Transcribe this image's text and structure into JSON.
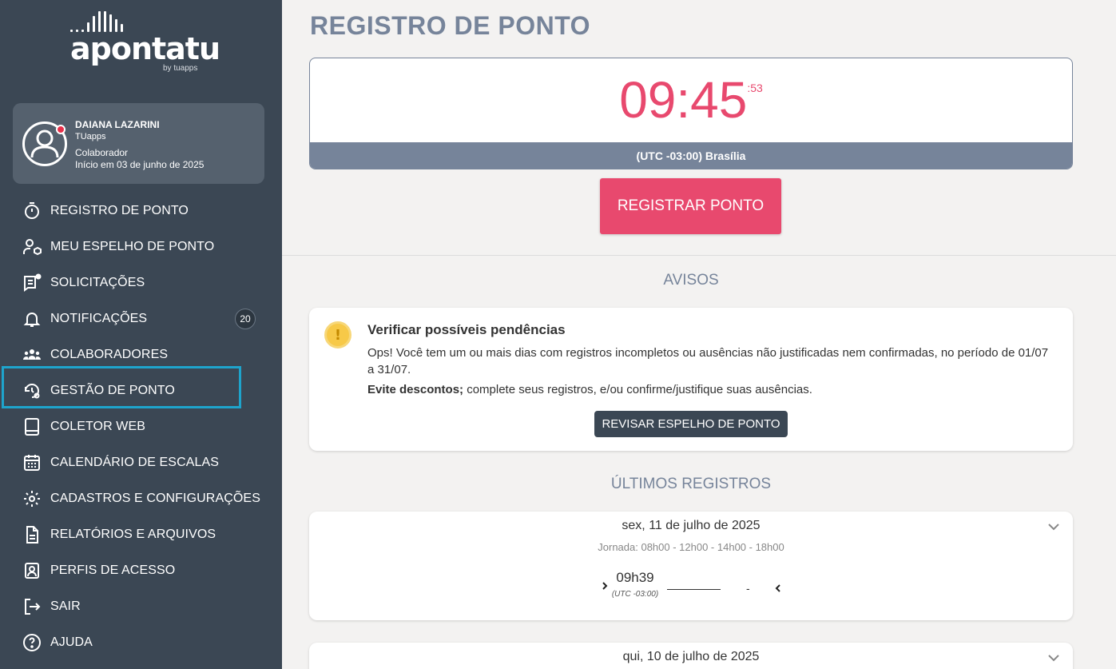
{
  "brand": {
    "logo_text": "apontatu",
    "by_text": "by tuapps"
  },
  "profile": {
    "name": "DAIANA LAZARINI",
    "company": "TUapps",
    "role": "Colaborador",
    "since": "Início em 03 de junho de 2025"
  },
  "nav": {
    "items": [
      {
        "label": "REGISTRO DE PONTO",
        "icon": "stopwatch-icon"
      },
      {
        "label": "MEU ESPELHO DE PONTO",
        "icon": "user-cube-icon"
      },
      {
        "label": "SOLICITAÇÕES",
        "icon": "message-list-icon"
      },
      {
        "label": "NOTIFICAÇÕES",
        "icon": "bell-icon",
        "badge": "20"
      },
      {
        "label": "COLABORADORES",
        "icon": "users-group-icon"
      },
      {
        "label": "GESTÃO DE PONTO",
        "icon": "history-gear-icon"
      },
      {
        "label": "COLETOR WEB",
        "icon": "tablet-icon"
      },
      {
        "label": "CALENDÁRIO DE ESCALAS",
        "icon": "calendar-icon"
      },
      {
        "label": "CADASTROS E CONFIGURAÇÕES",
        "icon": "gear-icon"
      },
      {
        "label": "RELATÓRIOS E ARQUIVOS",
        "icon": "document-icon"
      },
      {
        "label": "PERFIS DE ACESSO",
        "icon": "id-badge-icon"
      },
      {
        "label": "SAIR",
        "icon": "logout-icon"
      },
      {
        "label": "AJUDA",
        "icon": "help-icon"
      }
    ]
  },
  "main": {
    "title": "REGISTRO DE PONTO",
    "clock": {
      "hours_minutes": "09:45",
      "seconds": ":53",
      "timezone": "(UTC -03:00) Brasília"
    },
    "register_button": "REGISTRAR PONTO",
    "notices_title": "AVISOS",
    "notice": {
      "title": "Verificar possíveis pendências",
      "body": "Ops! Você tem um ou mais dias com registros incompletos ou ausências não justificadas nem confirmadas, no período de 01/07 a 31/07.",
      "tip_bold": "Evite descontos;",
      "tip_rest": " complete seus registros, e/ou confirme/justifique suas ausências.",
      "button": "REVISAR ESPELHO DE PONTO",
      "icon_glyph": "!"
    },
    "records_title": "ÚLTIMOS REGISTROS",
    "records": [
      {
        "date": "sex, 11 de julho de 2025",
        "journey": "Jornada: 08h00 - 12h00 - 14h00 - 18h00",
        "entry_time": "09h39",
        "entry_utc": "(UTC -03:00)",
        "dash": "-"
      },
      {
        "date": "qui, 10 de julho de 2025"
      }
    ]
  },
  "colors": {
    "sidebar_bg": "#3b4754",
    "accent_pink": "#e8496e",
    "slate": "#76849a",
    "highlight_border": "#1ea4cc"
  }
}
